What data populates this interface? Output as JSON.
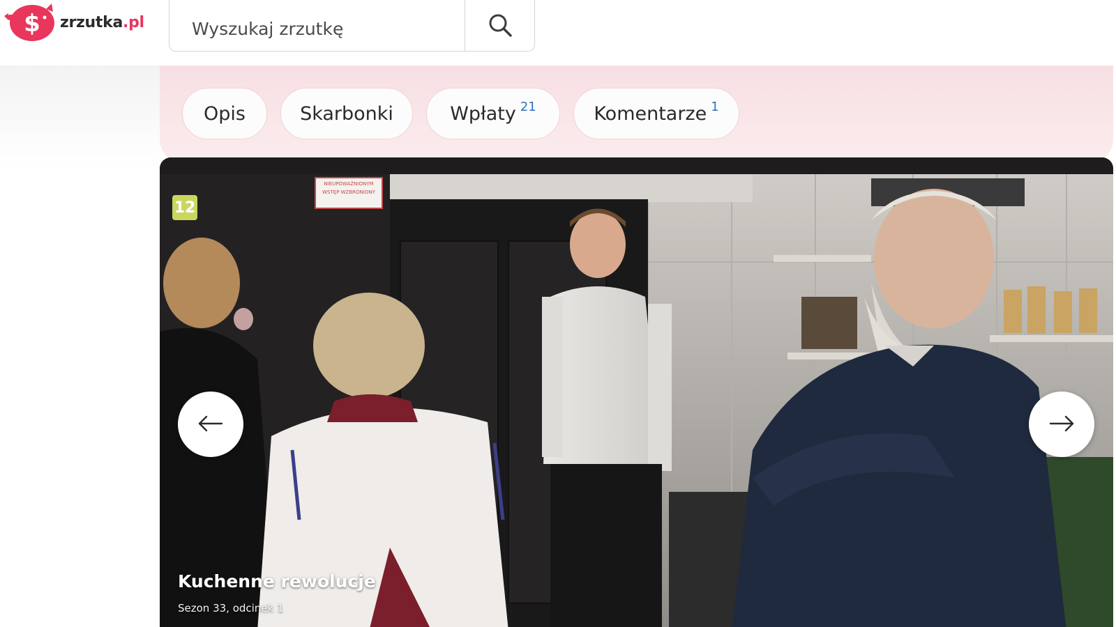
{
  "header": {
    "logo_text": "zrzutka",
    "logo_tld": ".pl",
    "search": {
      "placeholder": "Wyszukaj zrzutkę",
      "value": ""
    }
  },
  "tabs": [
    {
      "label": "Opis",
      "count": ""
    },
    {
      "label": "Skarbonki",
      "count": ""
    },
    {
      "label": "Wpłaty",
      "count": "21"
    },
    {
      "label": "Komentarze",
      "count": "1"
    }
  ],
  "media": {
    "age_rating": "12",
    "sign_text": "NIEUPOWAŻNIONYM WSTĘP WZBRONIONY",
    "title": "Kuchenne rewolucje",
    "subtitle": "Sezon 33, odcinek 1"
  },
  "colors": {
    "brand": "#e8365d",
    "tabs_bg": "#f7dfe3",
    "count_badge": "#2b73b8"
  },
  "icons": {
    "search": "search-icon",
    "prev": "arrow-left-icon",
    "next": "arrow-right-icon"
  }
}
